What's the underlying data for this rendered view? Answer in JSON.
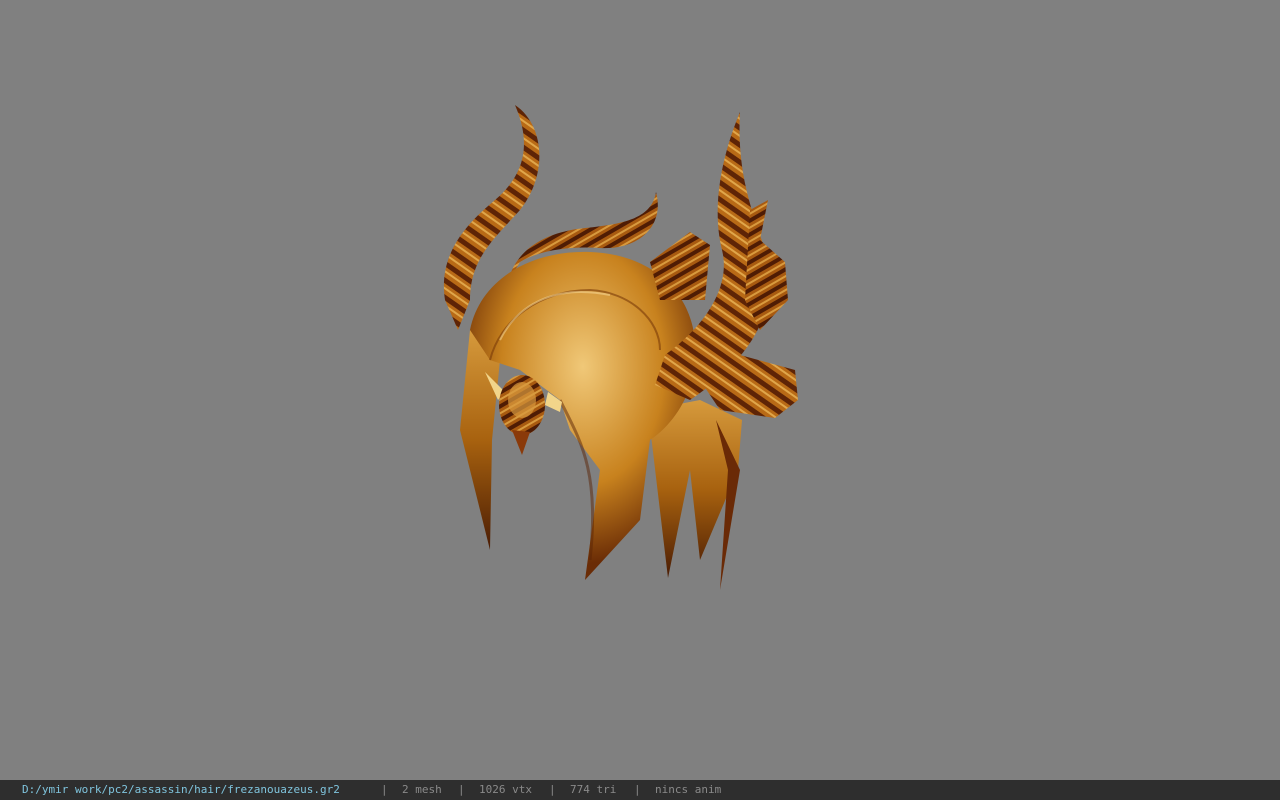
{
  "viewport": {
    "background_color": "#808080",
    "model": "horned-hair-mesh"
  },
  "status_bar": {
    "file_path": "D:/ymir work/pc2/assassin/hair/frezanouazeus.gr2",
    "separator": "|",
    "mesh_count": "2 mesh",
    "vertex_count": "1026 vtx",
    "triangle_count": "774 tri",
    "anim_status": "nincs anim",
    "path_color": "#7fc4dd",
    "text_color": "#8a8a8a",
    "background_color": "#2e2e2e"
  }
}
